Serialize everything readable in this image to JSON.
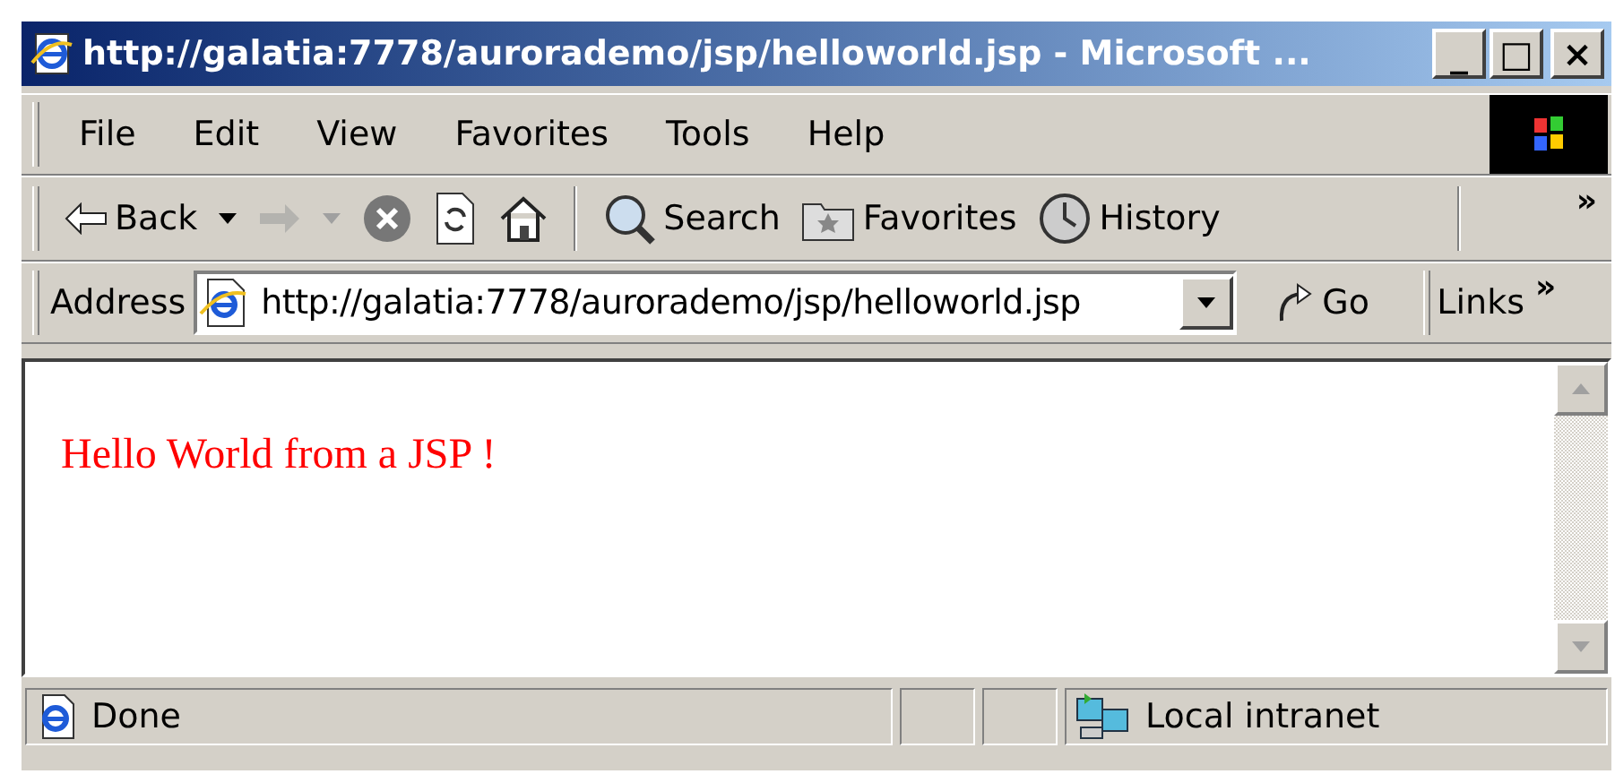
{
  "window": {
    "title": "http://galatia:7778/aurorademo/jsp/helloworld.jsp - Microsoft ...",
    "controls": [
      "_",
      "□",
      "×"
    ]
  },
  "menu": [
    "File",
    "Edit",
    "View",
    "Favorites",
    "Tools",
    "Help"
  ],
  "toolbar": [
    {
      "kind": "back",
      "label": "Back",
      "dropdown": true,
      "disabled": false
    },
    {
      "kind": "forward",
      "dropdown": true,
      "disabled": true
    },
    {
      "kind": "stop",
      "disabled": false
    },
    {
      "kind": "refresh",
      "disabled": false
    },
    {
      "kind": "home",
      "disabled": false
    },
    {
      "kind": "search",
      "label": "Search",
      "disabled": false
    },
    {
      "kind": "favorites",
      "label": "Favorites",
      "disabled": false
    },
    {
      "kind": "history",
      "label": "History",
      "disabled": false
    }
  ],
  "toolbar_more": "»",
  "address": {
    "label": "Address",
    "value": "http://galatia:7778/aurorademo/jsp/helloworld.jsp",
    "go": "Go",
    "links": "Links",
    "links_more": "»"
  },
  "content": {
    "text": "Hello World from a JSP !"
  },
  "status_bar": {
    "text": "Done",
    "zone": "Local intranet"
  }
}
